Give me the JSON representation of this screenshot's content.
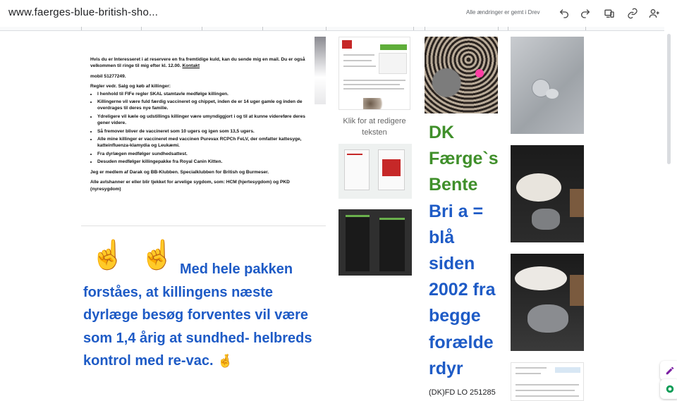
{
  "window": {
    "title": "www.faerges-blue-british-sho...",
    "save_status": "Alle ændringer er gemt i Drev",
    "icons": [
      "undo-icon",
      "redo-icon",
      "device-preview-icon",
      "link-icon",
      "add-person-icon"
    ]
  },
  "info": {
    "reserve_text": "Hvis du er Interesseret i at reservere en fra fremtidige kuld, kan du sende mig en mail. Du er også velkommen til ringe til mig efter kl. 12.00.",
    "contact_link": "Kontakt",
    "phone": "mobil 51277249.",
    "rules_heading": "Regler vedr. Salg og køb af killinger:",
    "rules": [
      "I henhold til FIFe regler SKAL stamtavle medfølge killingen.",
      "Killingerne vil være fuld færdig vaccineret og chippet, inden de er 14 uger gamle og inden de overdrages til deres nye familie.",
      "Ydreligere vil kæle og udstillings killinger være umyndiggjort i og til at kunne videreføre deres gener videre.",
      "Så fremover bliver de vaccineret som 10 ugers og igen som 13,5 ugers.",
      "Alle mine killinger er vaccineret med vaccinen Purevax RCPCh FeLV, der omfatter kattesyge, katteinfluenza-klamydia og Leukæmi.",
      "Fra dyrlægen medfølger sundhedsattest.",
      "Desuden medfølger killingepakke fra Royal Canin Kitten."
    ],
    "membership": "Jeg er medlem af Darak og BB-Klubben. Specialklubben for British og Burmeser.",
    "health": "Alle avlshanner er eller blir tjekket for arvelige sygdom, som: HCM (hjertesygdom) og PKD (nyresygdom)"
  },
  "promo": {
    "hand_emoji": "☝",
    "crossed_emoji": "🤞",
    "first_line": "Med hele pakken",
    "rest": "forståes, at killingens næste dyrlæge besøg forventes vil være som 1,4 årig at sundhed- helbreds kontrol med re-vac."
  },
  "middle": {
    "click_to_edit": "Klik for at redigere teksten"
  },
  "title": {
    "line_green": [
      "DK",
      "Færge`s",
      "Bente"
    ],
    "line_blue": [
      "Bri a =",
      "blå",
      "siden",
      "2002 fra",
      "begge",
      "forælde",
      "rdyr"
    ],
    "registration": "(DK)FD LO 251285"
  },
  "colors": {
    "green": "#3f8f2a",
    "blue": "#1e5bc6"
  }
}
